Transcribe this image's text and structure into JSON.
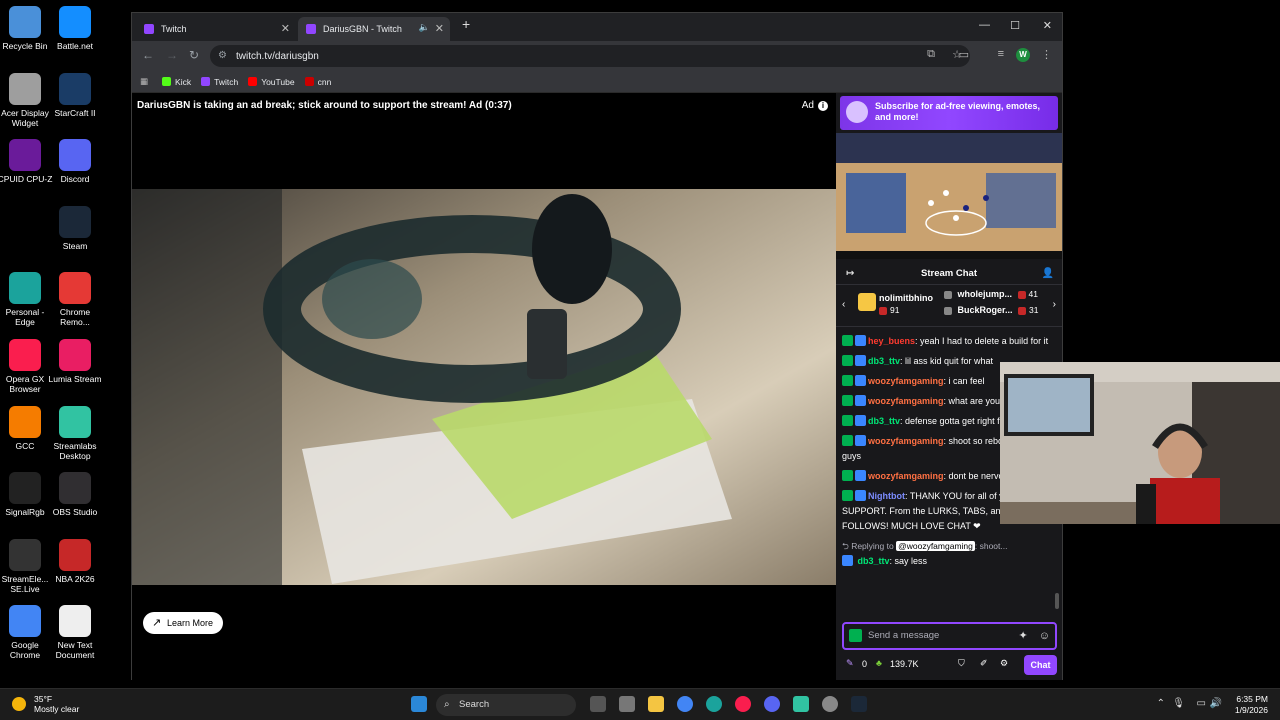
{
  "desktop": {
    "icons": [
      {
        "label": "Recycle Bin",
        "icon": "recycle-bin-icon",
        "color": "#4a90d9"
      },
      {
        "label": "Battle.net",
        "icon": "battlenet-icon",
        "color": "#148eff"
      },
      {
        "label": "Acer Display Widget",
        "icon": "acer-icon",
        "color": "#9e9e9e"
      },
      {
        "label": "StarCraft II",
        "icon": "starcraft-icon",
        "color": "#1a3c66"
      },
      {
        "label": "CPUID CPU-Z",
        "icon": "cpuz-icon",
        "color": "#6a1b9a"
      },
      {
        "label": "Discord",
        "icon": "discord-icon",
        "color": "#5865f2"
      },
      {
        "label": "Steam",
        "icon": "steam-icon",
        "color": "#1b2838"
      },
      {
        "label": "Personal - Edge",
        "icon": "edge-icon",
        "color": "#1ba39c"
      },
      {
        "label": "Chrome Remo...",
        "icon": "chrome-remote-icon",
        "color": "#e53935"
      },
      {
        "label": "Opera GX Browser",
        "icon": "opera-gx-icon",
        "color": "#fa1e4e"
      },
      {
        "label": "Lumia Stream",
        "icon": "lumia-icon",
        "color": "#e91e63"
      },
      {
        "label": "GCC",
        "icon": "gcc-icon",
        "color": "#f57c00"
      },
      {
        "label": "Streamlabs Desktop",
        "icon": "streamlabs-icon",
        "color": "#31c3a2"
      },
      {
        "label": "SignalRgb",
        "icon": "signalrgb-icon",
        "color": "#222"
      },
      {
        "label": "OBS Studio",
        "icon": "obs-icon",
        "color": "#302e31"
      },
      {
        "label": "StreamEle... SE.Live",
        "icon": "streamelements-icon",
        "color": "#333"
      },
      {
        "label": "NBA 2K26",
        "icon": "nba2k-icon",
        "color": "#c62828"
      },
      {
        "label": "Google Chrome",
        "icon": "chrome-icon",
        "color": "#4285f4"
      },
      {
        "label": "New Text Document",
        "icon": "text-document-icon",
        "color": "#eeeeee"
      }
    ]
  },
  "browser": {
    "tabs": [
      {
        "title": "Twitch",
        "active": false
      },
      {
        "title": "DariusGBN - Twitch",
        "active": true
      }
    ],
    "url": "twitch.tv/dariusgbn",
    "profile_initial": "W",
    "bookmarks": [
      {
        "label": "Kick",
        "color": "#53fc18"
      },
      {
        "label": "Twitch",
        "color": "#9146ff"
      },
      {
        "label": "YouTube",
        "color": "#ff0000"
      },
      {
        "label": "cnn",
        "color": "#cc0000"
      }
    ]
  },
  "player": {
    "ad_message": "DariusGBN is taking an ad break; stick around to support the stream! Ad (0:37)",
    "ad_label": "Ad",
    "learn_more": "Learn More"
  },
  "panel": {
    "subscribe_banner": "Subscribe for ad-free viewing, emotes, and more!",
    "chat_title": "Stream Chat",
    "leaderboard": [
      {
        "name": "nolimitbhino",
        "count": "91"
      },
      {
        "name": "wholejump...",
        "count": "41"
      },
      {
        "name": "BuckRoger...",
        "count": "31"
      }
    ],
    "messages": [
      {
        "user": "hey_buens",
        "color": "#ff3b30",
        "text": ": yeah I had to delete a build for it"
      },
      {
        "user": "db3_ttv",
        "color": "#00e676",
        "text": ": lil ass kid quit for what"
      },
      {
        "user": "woozyfamgaming",
        "color": "#ff7043",
        "text": ": i can feel"
      },
      {
        "user": "woozyfamgaming",
        "color": "#ff7043",
        "text": ": what are you doing"
      },
      {
        "user": "db3_ttv",
        "color": "#00e676",
        "text": ": defense gotta get right fr!"
      },
      {
        "user": "woozyfamgaming",
        "color": "#ff7043",
        "text": ": shoot so rebound for you guys"
      },
      {
        "user": "woozyfamgaming",
        "color": "#ff7043",
        "text": ": dont be nervous"
      },
      {
        "user": "Nightbot",
        "color": "#7c8cff",
        "text": ": THANK YOU for all of your SUPPORT. From the LURKS, TABS, and FOLLOWS! MUCH LOVE CHAT ❤"
      }
    ],
    "reply": {
      "prefix": "Replying to",
      "mention": "@woozyfamgaming",
      "snippet": ": shoot...",
      "user": "db3_ttv",
      "text": ": say less"
    },
    "input_placeholder": "Send a message",
    "points": "0",
    "channel_points": "139.7K",
    "chat_button": "Chat"
  },
  "taskbar": {
    "weather_temp": "35°F",
    "weather_desc": "Mostly clear",
    "search_placeholder": "Search",
    "time": "6:35 PM",
    "date": "1/9/2026"
  }
}
